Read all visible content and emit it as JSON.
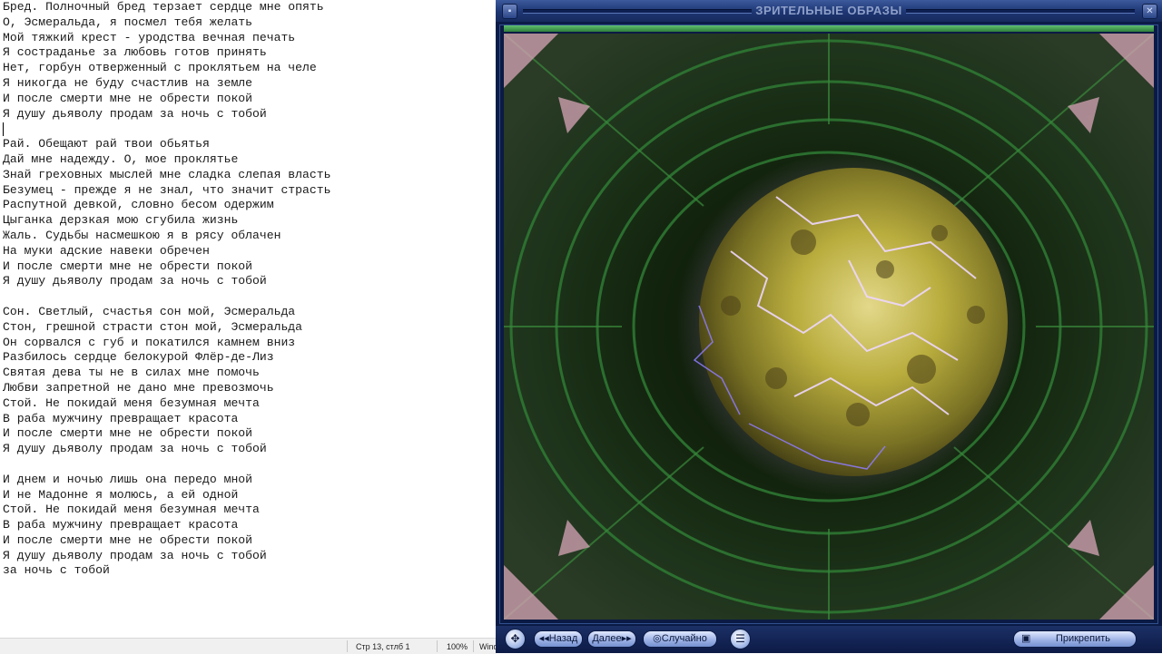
{
  "notepad": {
    "lines": [
      "Бред. Полночный бред терзает сердце мне опять",
      "О, Эсмеральда, я посмел тебя желать",
      "Мой тяжкий крест - уродства вечная печать",
      "Я состраданье за любовь готов принять",
      "Нет, горбун отверженный с проклятьем на челе",
      "Я никогда не буду счастлив на земле",
      "И после смерти мне не обрести покой",
      "Я душу дьяволу продам за ночь с тобой",
      "",
      "Рай. Обещают рай твои обьятья",
      "Дай мне надежду. О, мое проклятье",
      "Знай греховных мыслей мне сладка слепая власть",
      "Безумец - прежде я не знал, что значит страсть",
      "Распутной девкой, словно бесом одержим",
      "Цыганка дерзкая мою сгубила жизнь",
      "Жаль. Судьбы насмешкою я в рясу облачен",
      "На муки адские навеки обречен",
      "И после смерти мне не обрести покой",
      "Я душу дьяволу продам за ночь с тобой",
      "",
      "Сон. Светлый, счастья сон мой, Эсмеральда",
      "Стон, грешной страсти стон мой, Эсмеральда",
      "Он сорвался с губ и покатился камнем вниз",
      "Разбилось сердце белокурой Флёр-де-Лиз",
      "Святая дева ты не в силах мне помочь",
      "Любви запретной не дано мне превозмочь",
      "Стой. Не покидай меня безумная мечта",
      "В раба мужчину превращает красота",
      "И после смерти мне не обрести покой",
      "Я душу дьяволу продам за ночь с тобой",
      "",
      "И днем и ночью лишь она передо мной",
      "И не Мадонне я молюсь, а ей одной",
      "Стой. Не покидай меня безумная мечта",
      "В раба мужчину превращает красота",
      "И после смерти мне не обрести покой",
      "Я душу дьяволу продам за ночь с тобой",
      "за ночь с тобой"
    ],
    "status": {
      "position": "Стр 13, стлб 1",
      "zoom": "100%",
      "line_ending": "Wind"
    }
  },
  "player": {
    "title": "ЗРИТЕЛЬНЫЕ ОБРАЗЫ",
    "controls": {
      "back": "◂◂Назад",
      "next": "Далее▸▸",
      "random": "◎Случайно",
      "pin": "Прикрепить"
    },
    "icons": {
      "move": "move-icon",
      "menu": "menu-icon",
      "pin": "pin-icon"
    },
    "colors": {
      "frame": "#0c1b48",
      "accent_green": "#3f9a4b",
      "sphere": "#b7ad3c",
      "lightning": "#e6c8ff"
    }
  }
}
